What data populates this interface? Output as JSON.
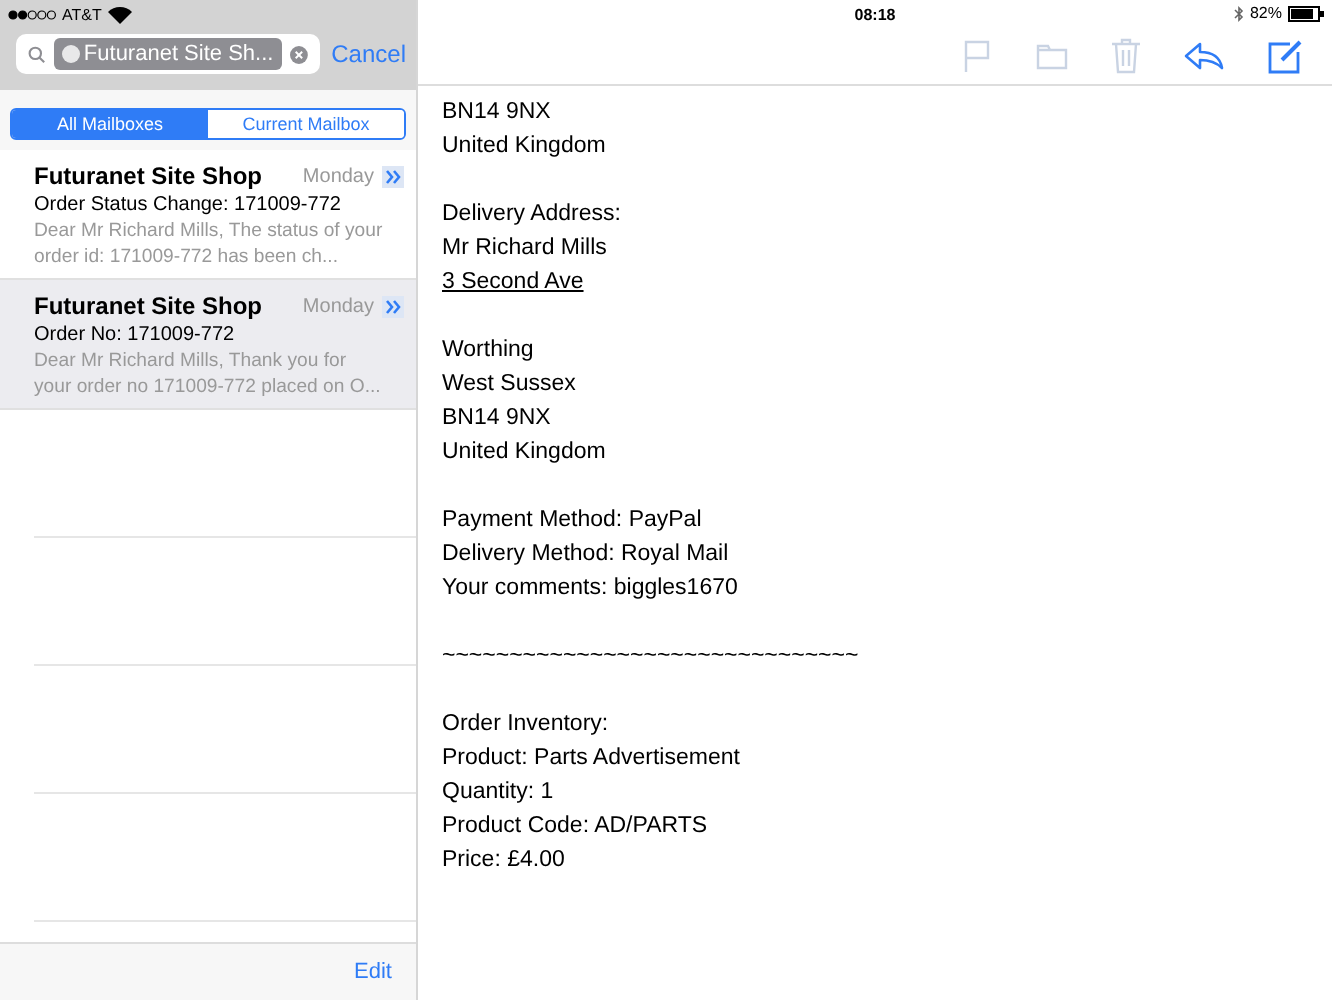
{
  "status_bar": {
    "carrier": "AT&T",
    "time": "08:18",
    "battery": "82%"
  },
  "search": {
    "token": "Futuranet Site Sh...",
    "cancel": "Cancel"
  },
  "segments": [
    {
      "label": "All Mailboxes",
      "selected": true
    },
    {
      "label": "Current Mailbox",
      "selected": false
    }
  ],
  "messages": [
    {
      "sender": "Futuranet Site Shop",
      "date": "Monday",
      "subject": "Order Status Change: 171009-772",
      "preview": "Dear Mr Richard Mills, The status of your order id: 171009-772 has been ch...",
      "selected": false
    },
    {
      "sender": "Futuranet Site Shop",
      "date": "Monday",
      "subject": "Order No: 171009-772",
      "preview": "Dear Mr Richard Mills, Thank you for your order no 171009-772 placed on O...",
      "selected": true
    }
  ],
  "edit": "Edit",
  "body": [
    [
      {
        "text": "BN14 9NX"
      },
      {
        "text": "United Kingdom"
      }
    ],
    [
      {
        "text": "Delivery Address:"
      },
      {
        "text": "Mr Richard Mills"
      },
      {
        "text": "3 Second Ave",
        "underlined": true
      }
    ],
    [
      {
        "text": "Worthing"
      },
      {
        "text": "West Sussex"
      },
      {
        "text": "BN14 9NX"
      },
      {
        "text": "United Kingdom"
      }
    ],
    [
      {
        "text": "Payment Method: PayPal"
      },
      {
        "text": "Delivery Method: Royal Mail"
      },
      {
        "text": "Your comments: biggles1670"
      }
    ],
    [
      {
        "text": "~~~~~~~~~~~~~~~~~~~~~~~~~~~~~~~"
      }
    ],
    [
      {
        "text": "Order Inventory:"
      },
      {
        "text": "Product: Parts Advertisement"
      },
      {
        "text": "Quantity: 1"
      },
      {
        "text": "Product Code: AD/PARTS"
      },
      {
        "text": "Price: £4.00"
      }
    ]
  ]
}
